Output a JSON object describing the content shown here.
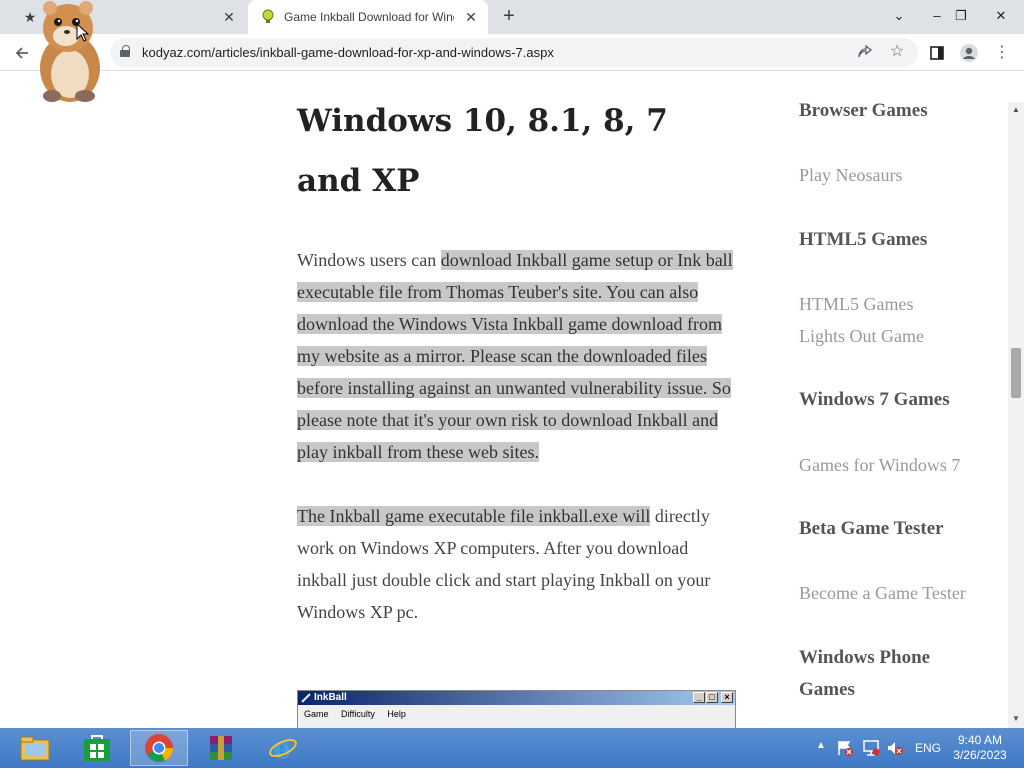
{
  "browser": {
    "tabs": [
      {
        "title": "B",
        "active": false,
        "icon": "star-icon"
      },
      {
        "title": "Game Inkball Download for Windows",
        "active": true,
        "icon": "kodyaz-lightbulb-icon"
      }
    ],
    "new_tab_symbol": "+",
    "window_controls": {
      "dropdown": "⌄",
      "minimize": "–",
      "restore": "❐",
      "close": "✕"
    },
    "url": "kodyaz.com/articles/inkball-game-download-for-xp-and-windows-7.aspx",
    "toolbar_icons": [
      "back-icon",
      "share-icon",
      "bookmark-star-icon",
      "side-panel-icon",
      "profile-icon",
      "menu-icon"
    ]
  },
  "article": {
    "heading": "Windows 10, 8.1, 8, 7 and XP",
    "p1_plain": "Windows users can ",
    "p1_highlighted": "download Inkball game setup or Ink ball executable file from Thomas Teuber's site. You can also download the Windows Vista Inkball game download from my website as a mirror. Please scan the downloaded files before installing against an unwanted vulnerability issue. So please note that it's your own risk to download Inkball and play inkball from these web sites.",
    "p2_highlighted": "The Inkball game executable file inkball.exe will",
    "p2_plain": " directly work on Windows XP computers. After you download inkball just double click and start playing Inkball on your Windows XP pc.",
    "inkball_window": {
      "title": "InkBall",
      "menu": [
        "Game",
        "Difficulty",
        "Help"
      ]
    }
  },
  "sidebar": {
    "sections": [
      {
        "heading": "Browser Games",
        "links": [
          "Play Neosaurs"
        ]
      },
      {
        "heading": "HTML5 Games",
        "links": [
          "HTML5 Games",
          "Lights Out Game"
        ]
      },
      {
        "heading": "Windows 7 Games",
        "links": [
          "Games for Windows 7"
        ]
      },
      {
        "heading": "Beta Game Tester",
        "links": [
          "Become a Game Tester"
        ]
      },
      {
        "heading": "Windows Phone Games",
        "links": []
      }
    ]
  },
  "taskbar": {
    "apps": [
      "file-explorer-icon",
      "windows-store-icon",
      "chrome-icon",
      "winrar-icon",
      "internet-explorer-icon"
    ],
    "active_app": "chrome-icon",
    "tray": {
      "language": "ENG",
      "time": "9:40 AM",
      "date": "3/26/2023"
    }
  },
  "colors": {
    "highlight": "#c8c8c8",
    "taskbar": "#4a84cc",
    "tabstrip": "#dee1e6"
  }
}
